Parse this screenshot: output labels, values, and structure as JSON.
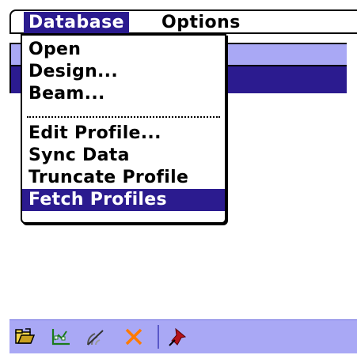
{
  "menubar": {
    "titles": [
      "Database",
      "Options"
    ],
    "active": "Database"
  },
  "dropdown": {
    "items": [
      "Open",
      "Design...",
      "Beam...",
      "Edit Profile...",
      "Sync Data",
      "Truncate Profile",
      "Fetch Profiles"
    ],
    "selected": "Fetch Profiles"
  },
  "toolbar": {
    "icons": [
      "open-folder-icon",
      "chart-edit-icon",
      "beam-icon",
      "delete-icon",
      "pin-icon"
    ]
  },
  "colors": {
    "accent_dark": "#2b1b8f",
    "accent_light": "#a9a8f5",
    "delete": "#ff7a00",
    "pin": "#b5121b"
  }
}
